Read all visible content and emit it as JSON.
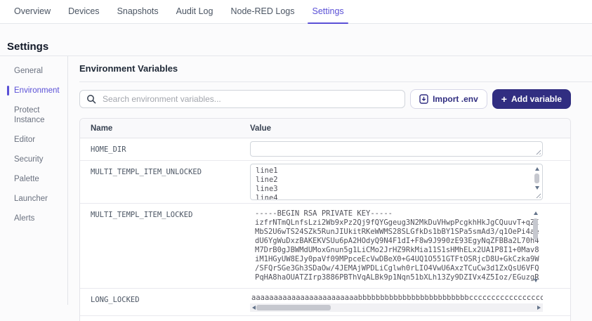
{
  "tabs": [
    {
      "label": "Overview"
    },
    {
      "label": "Devices"
    },
    {
      "label": "Snapshots"
    },
    {
      "label": "Audit Log"
    },
    {
      "label": "Node-RED Logs"
    },
    {
      "label": "Settings"
    }
  ],
  "active_tab": "Settings",
  "page_title": "Settings",
  "sidebar": {
    "items": [
      {
        "label": "General"
      },
      {
        "label": "Environment"
      },
      {
        "label": "Protect Instance"
      },
      {
        "label": "Editor"
      },
      {
        "label": "Security"
      },
      {
        "label": "Palette"
      },
      {
        "label": "Launcher"
      },
      {
        "label": "Alerts"
      }
    ],
    "active_item": "Environment"
  },
  "main": {
    "heading": "Environment Variables",
    "search": {
      "placeholder": "Search environment variables...",
      "value": "",
      "icon": "search-icon"
    },
    "buttons": {
      "import": {
        "label": "Import .env",
        "icon": "file-import-icon"
      },
      "add": {
        "label": "Add variable",
        "icon": "plus-icon",
        "plus": "+"
      }
    },
    "table": {
      "columns": [
        "Name",
        "Value"
      ],
      "rows": [
        {
          "name": "HOME_DIR",
          "value": "",
          "locked": false
        },
        {
          "name": "MULTI_TEMPL_ITEM_UNLOCKED",
          "value": "line1\nline2\nline3\nline4",
          "locked": false
        },
        {
          "name": "MULTI_TEMPL_ITEM_LOCKED",
          "value": "-----BEGIN RSA PRIVATE KEY-----\nizfrNTmQLnfsLzi2Wb9xPz2Qj9fQYGgeug3N2MkDuVHwpPcgkhHkJgCQuuvT+qZI\nMbS2U6wTS24SZk5RunJIUkitRKeWWMS28SLGfkDs1bBY1SPa5smAd3/q1OePi4ae\ndU6YgWuDxzBAKEKVSUu6pA2HOdyQ9N4F1dI+F8w9J990zE93EgyNqZFBBa2L70h4\nM7DrB0gJBWMdUMoxGnun5g1LiCMo2JrHZ9RkMia11S1sHMhELx2UA1P8I1+0Mav8\niM1HGyUW8EJy0paVf09MPpceEcVwDBeX0+G4UQ1O551GTFtOSRjcD8U+GkCzka9W\n/SFQrSGe3Gh3SDaOw/4JEMAjWPDLiCglwh0rLIO4VwU6AxzTCuCw3d1ZxQsU6VFQ\nPqHA8haOUATZIrp3886PBThVqALBk9p1Nqn51bXLh13Zy9DZIVx4Z5Ioz/EGuzgR",
          "locked": true
        },
        {
          "name": "LONG_LOCKED",
          "value": "aaaaaaaaaaaaaaaaaaaaaaaabbbbbbbbbbbbbbbbbbbbbbbbbccccccccccccccccccccccccccccdddddddddddddddddddddddddddddddddddddddd",
          "locked": true
        }
      ]
    }
  },
  "colors": {
    "accent": "#5a50d6",
    "primary_button": "#312e81",
    "table_header_bg": "#f9f9fb",
    "border": "#e5e7eb"
  }
}
